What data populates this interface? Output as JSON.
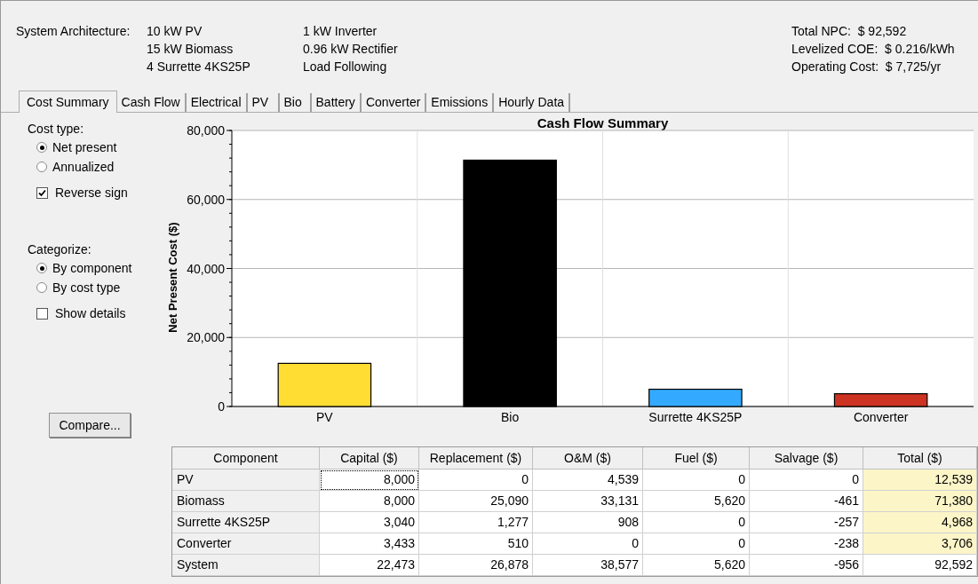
{
  "summary": {
    "label": "System Architecture:",
    "architecture_col1": [
      "10 kW PV",
      "15 kW Biomass",
      "4 Surrette 4KS25P"
    ],
    "architecture_col2": [
      "1 kW Inverter",
      "0.96 kW Rectifier",
      "Load Following"
    ],
    "totals": [
      "Total NPC:  $ 92,592",
      "Levelized COE:  $ 0.216/kWh",
      "Operating Cost:  $ 7,725/yr"
    ]
  },
  "tabs": [
    {
      "label": "Cost Summary",
      "selected": true
    },
    {
      "label": "Cash Flow",
      "selected": false
    },
    {
      "label": "Electrical",
      "selected": false
    },
    {
      "label": "PV",
      "selected": false
    },
    {
      "label": "Bio",
      "selected": false
    },
    {
      "label": "Battery",
      "selected": false
    },
    {
      "label": "Converter",
      "selected": false
    },
    {
      "label": "Emissions",
      "selected": false
    },
    {
      "label": "Hourly Data",
      "selected": false
    }
  ],
  "cost_type": {
    "label": "Cost type:",
    "options": [
      {
        "label": "Net present",
        "selected": true
      },
      {
        "label": "Annualized",
        "selected": false
      }
    ],
    "reverse_sign": {
      "label": "Reverse sign",
      "checked": true
    }
  },
  "categorize": {
    "label": "Categorize:",
    "options": [
      {
        "label": "By component",
        "selected": true
      },
      {
        "label": "By cost type",
        "selected": false
      }
    ],
    "show_details": {
      "label": "Show details",
      "checked": false
    }
  },
  "compare_button": "Compare...",
  "chart_data": {
    "type": "bar",
    "title": "Cash Flow Summary",
    "ylabel": "Net Present Cost ($)",
    "categories": [
      "PV",
      "Bio",
      "Surrette 4KS25P",
      "Converter"
    ],
    "stacked": true,
    "grid": true,
    "series": [
      {
        "color": "#ffdd33",
        "values": [
          12500,
          null,
          null,
          null
        ]
      },
      {
        "color": "#000000",
        "values": [
          null,
          71400,
          null,
          null
        ]
      },
      {
        "color": "#33aaff",
        "values": [
          null,
          null,
          5000,
          null
        ]
      },
      {
        "color": "#cc3322",
        "values": [
          null,
          null,
          null,
          3700
        ]
      }
    ],
    "ylim": [
      0,
      80000
    ],
    "yticks": [
      {
        "value": 0,
        "label": "0"
      },
      {
        "value": 20000,
        "label": "20,000"
      },
      {
        "value": 40000,
        "label": "40,000"
      },
      {
        "value": 60000,
        "label": "60,000"
      },
      {
        "value": 80000,
        "label": "80,000"
      }
    ]
  },
  "table": {
    "columns": [
      "Component",
      "Capital ($)",
      "Replacement ($)",
      "O&M ($)",
      "Fuel ($)",
      "Salvage ($)",
      "Total ($)"
    ],
    "rows": [
      {
        "cells": [
          "PV",
          "8,000",
          "0",
          "4,539",
          "0",
          "0",
          "12,539"
        ],
        "highlight_total": true
      },
      {
        "cells": [
          "Biomass",
          "8,000",
          "25,090",
          "33,131",
          "5,620",
          "-461",
          "71,380"
        ],
        "highlight_total": true
      },
      {
        "cells": [
          "Surrette 4KS25P",
          "3,040",
          "1,277",
          "908",
          "0",
          "-257",
          "4,968"
        ],
        "highlight_total": true
      },
      {
        "cells": [
          "Converter",
          "3,433",
          "510",
          "0",
          "0",
          "-238",
          "3,706"
        ],
        "highlight_total": true
      },
      {
        "cells": [
          "System",
          "22,473",
          "26,878",
          "38,577",
          "5,620",
          "-956",
          "92,592"
        ],
        "highlight_total": false
      }
    ]
  }
}
